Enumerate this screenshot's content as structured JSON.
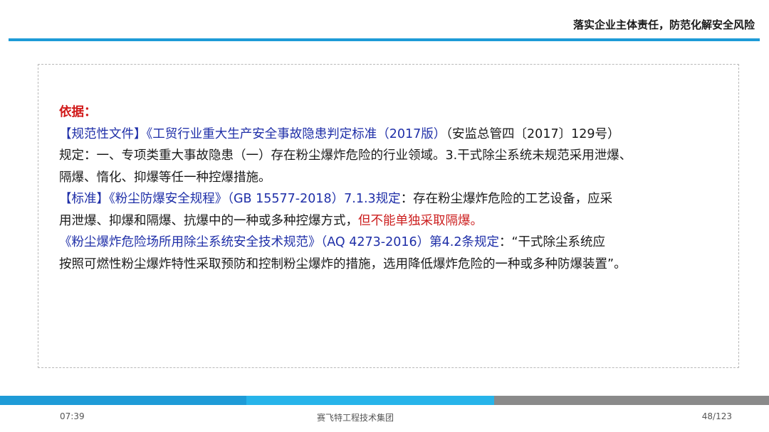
{
  "header": {
    "title": "落实企业主体责任，防范化解安全风险"
  },
  "content": {
    "basis_label": "依据：",
    "line2_blue": "【规范性文件】《工贸行业重大生产安全事故隐患判定标准（2017版）",
    "line2_rest": "（安监总管四〔2017〕129号）",
    "line3": "规定：一、专项类重大事故隐患（一）存在粉尘爆炸危险的行业领域。3.干式除尘系统未规范采用泄爆、",
    "line4": "隔爆、惰化、抑爆等任一种控爆措施。",
    "line5_blue": "【标准】《粉尘防爆安全规程》（GB 15577-2018）7.1.3规定",
    "line5_rest": "：存在粉尘爆炸危险的工艺设备，应采",
    "line6_black": "用泄爆、抑爆和隔爆、抗爆中的一种或多种控爆方式，",
    "line6_red": "但不能单独采取隔爆。",
    "line7_blue": "《粉尘爆炸危险场所用除尘系统安全技术规范》（AQ 4273-2016）第4.2条规定",
    "line7_rest": "：“干式除尘系统应",
    "line8": "按照可燃性粉尘爆炸特性采取预防和控制粉尘爆炸的措施，选用降低爆炸危险的一种或多种防爆装置”。"
  },
  "footer": {
    "time": "07:39",
    "company": "赛飞特工程技术集团",
    "page": "48/123"
  },
  "colors": {
    "accent_blue": "#1e9bd7",
    "light_blue": "#27b4ea",
    "gray": "#8a8a8a",
    "text_blue": "#1f2fa8",
    "text_red": "#cc1f1f"
  }
}
